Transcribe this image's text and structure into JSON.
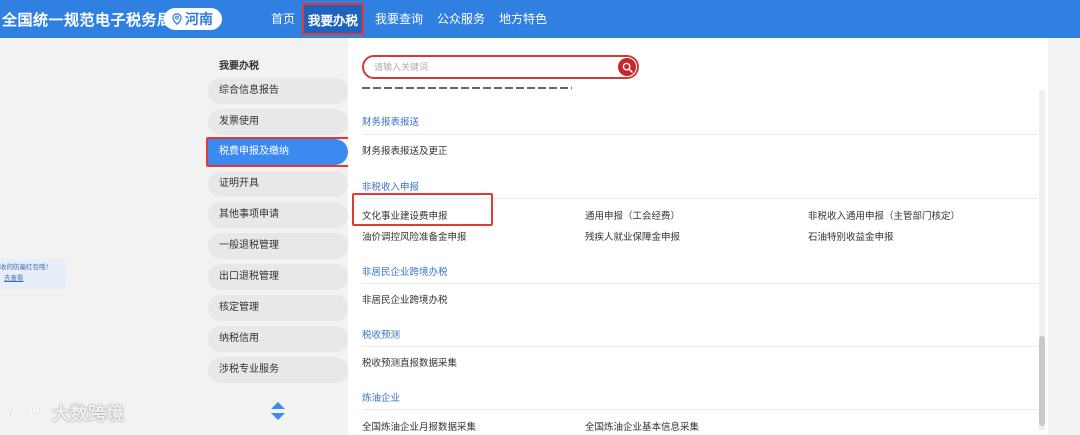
{
  "header": {
    "site_title": "全国统一规范电子税务局",
    "region": "河南",
    "nav": [
      {
        "label": "首页"
      },
      {
        "label": "我要办税"
      },
      {
        "label": "我要查询"
      },
      {
        "label": "公众服务"
      },
      {
        "label": "地方特色"
      }
    ]
  },
  "tip": {
    "line1": "收的防骗红包哦！",
    "link": "去查看"
  },
  "watermark": "大数跨境",
  "sidebar": {
    "heading": "我要办税",
    "items": [
      {
        "label": "综合信息报告"
      },
      {
        "label": "发票使用"
      },
      {
        "label": "税费申报及缴纳"
      },
      {
        "label": "证明开具"
      },
      {
        "label": "其他事项申请"
      },
      {
        "label": "一般退税管理"
      },
      {
        "label": "出口退税管理"
      },
      {
        "label": "核定管理"
      },
      {
        "label": "纳税信用"
      },
      {
        "label": "涉税专业服务"
      }
    ]
  },
  "search": {
    "placeholder": "请输入关键词"
  },
  "sections": [
    {
      "title": "财务报表报送",
      "entries": [
        {
          "label": "财务报表报送及更正"
        }
      ]
    },
    {
      "title": "非税收入申报",
      "entries": [
        {
          "label": "文化事业建设费申报"
        },
        {
          "label": "通用申报（工会经费）"
        },
        {
          "label": "非税收入通用申报（主管部门核定）"
        },
        {
          "label": "油价调控风险准备金申报"
        },
        {
          "label": "残疾人就业保障金申报"
        },
        {
          "label": "石油特别收益金申报"
        }
      ]
    },
    {
      "title": "非居民企业跨境办税",
      "entries": [
        {
          "label": "非居民企业跨境办税"
        }
      ]
    },
    {
      "title": "税收预测",
      "entries": [
        {
          "label": "税收预测直报数据采集"
        }
      ]
    },
    {
      "title": "炼油企业",
      "entries": [
        {
          "label": "全国炼油企业月报数据采集"
        },
        {
          "label": "全国炼油企业基本信息采集"
        }
      ]
    }
  ],
  "colors": {
    "header_bg": "#2f80e0",
    "active_nav_bg": "#1f63bd",
    "highlight": "#e53935",
    "active_side": "#3c8af0",
    "section_title": "#3a73c9"
  }
}
